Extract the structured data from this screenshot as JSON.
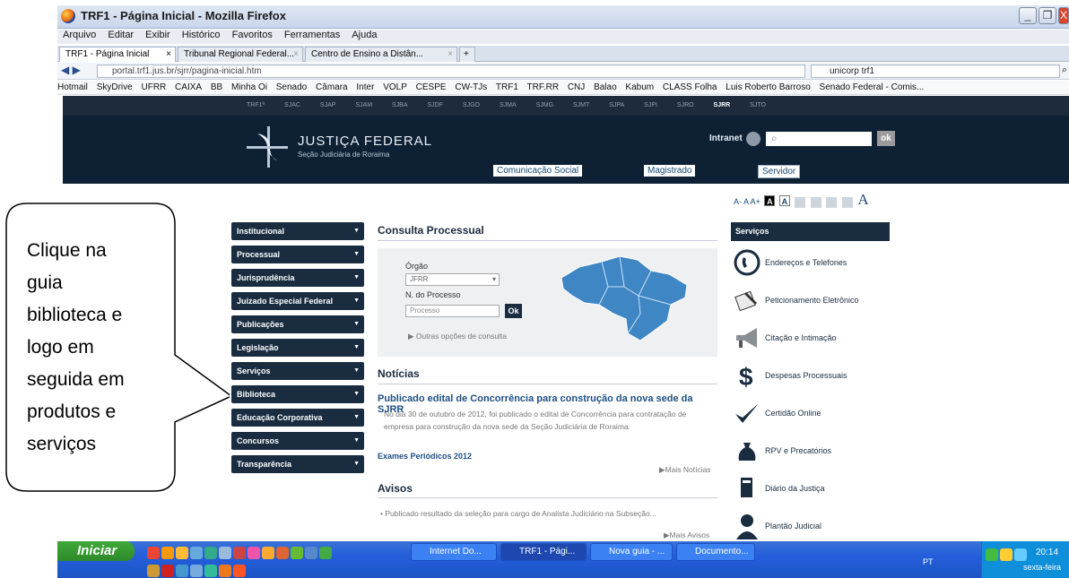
{
  "window": {
    "title": "TRF1 - Página Inicial - Mozilla Firefox",
    "min": "_",
    "max": "❐",
    "close": "X"
  },
  "menubar": [
    "Arquivo",
    "Editar",
    "Exibir",
    "Histórico",
    "Favoritos",
    "Ferramentas",
    "Ajuda"
  ],
  "tabs": [
    {
      "label": "TRF1 - Página Inicial",
      "close": "×"
    },
    {
      "label": "Tribunal Regional Federal...",
      "close": "×"
    },
    {
      "label": "Centro de Ensino a Distân...",
      "close": "×"
    },
    {
      "label": "+"
    }
  ],
  "nav": {
    "url": "portal.trf1.jus.br/sjrr/pagina-inicial.htm",
    "search": "unicorp trf1"
  },
  "bookmarks": [
    "Hotmail",
    "SkyDrive",
    "UFRR",
    "CAIXA",
    "BB",
    "Minha Oi",
    "Senado",
    "Câmara",
    "Inter",
    "VOLP",
    "CESPE",
    "CW-TJs",
    "TRF1",
    "TRF.RR",
    "CNJ",
    "Balao",
    "Kabum",
    "CLASS Folha",
    "Luis Roberto Barroso",
    "Senado Federal - Comis..."
  ],
  "topnav": [
    "TRF1ª",
    "SJAC",
    "SJAP",
    "SJAM",
    "SJBA",
    "SJDF",
    "SJGO",
    "SJMA",
    "SJMG",
    "SJMT",
    "SJPA",
    "SJPI",
    "SJRO",
    "SJRR",
    "SJTO"
  ],
  "header": {
    "title": "JUSTIÇA FEDERAL",
    "subtitle": "Seção Judiciária de Roraima",
    "intranet": "Intranet",
    "ok": "ok",
    "nav": [
      "Comunicação Social",
      "Magistrado",
      "Servidor"
    ]
  },
  "fontctl": {
    "a_minus": "A-",
    "a": "A",
    "a_plus": "A+",
    "contrast1": "A",
    "contrast2": "A"
  },
  "left_menu": [
    "Institucional",
    "Processual",
    "Jurisprudência",
    "Juizado Especial Federal",
    "Publicações",
    "Legislação",
    "Serviços",
    "Biblioteca",
    "Educação Corporativa",
    "Concursos",
    "Transparência"
  ],
  "consulta": {
    "title": "Consulta Processual",
    "orgao_label": "Órgão",
    "orgao_value": "JFRR",
    "num_label": "N. do Processo",
    "num_placeholder": "Processo",
    "ok": "Ok",
    "more": "Outras opções de consulta"
  },
  "noticias": {
    "title": "Notícias",
    "headline": "Publicado edital de Concorrência para construção da nova sede da SJRR",
    "body": "No dia 30 de outubro de 2012, foi publicado o edital de Concorrência para contratação de empresa para construção da nova sede da Seção Judiciária de Roraima.",
    "item2": "Exames Periódicos 2012",
    "more": "Mais Notícias"
  },
  "avisos": {
    "title": "Avisos",
    "item": "Publicado resultado da seleção para cargo de Analista Judiciário na Subseção...",
    "more": "Mais Avisos"
  },
  "servicos": {
    "title": "Serviços",
    "items": [
      "Endereços e Telefones",
      "Peticionamento Eletrônico",
      "Citação e Intimação",
      "Despesas Processuais",
      "Certidão Online",
      "RPV e Precatórios",
      "Diário da Justiça",
      "Plantão Judicial"
    ]
  },
  "callout": {
    "lines": [
      "Clique na",
      "guia",
      "biblioteca e",
      "logo em",
      "seguida em",
      "produtos e",
      "serviços"
    ]
  },
  "taskbar": {
    "start": "Iniciar",
    "buttons": [
      "Internet Do...",
      "TRF1 - Pági...",
      "Nova guia - ...",
      "Documento..."
    ],
    "lang": "PT",
    "time": "20:14",
    "day": "sexta-feira"
  }
}
